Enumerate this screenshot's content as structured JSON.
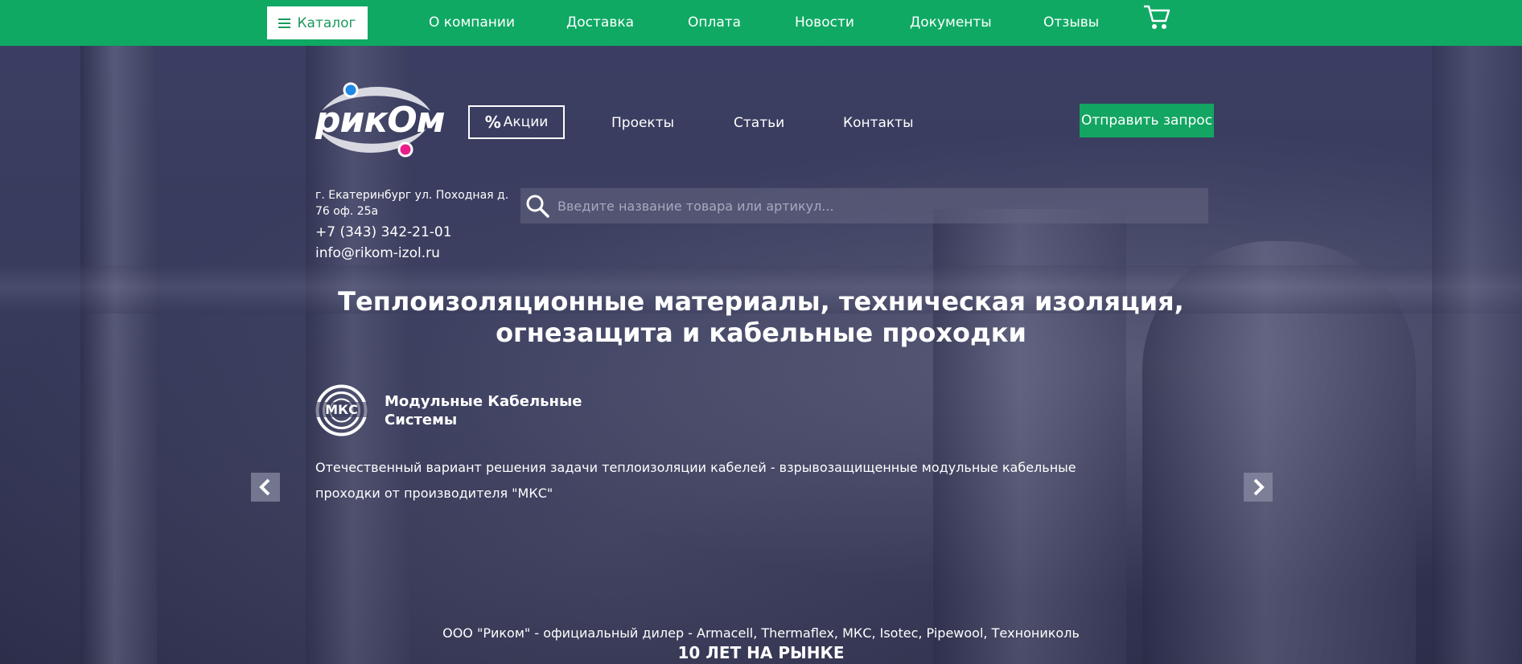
{
  "topbar": {
    "catalog_label": "Каталог",
    "nav": [
      "О компании",
      "Доставка",
      "Оплата",
      "Новости",
      "Документы",
      "Отзывы"
    ]
  },
  "header": {
    "logo_text": "рикОм",
    "promo_label": "Акции",
    "promo_symbol": "%",
    "nav": [
      "Проекты",
      "Статьи",
      "Контакты"
    ],
    "request_button": "Отправить запрос"
  },
  "contacts": {
    "address": "г. Екатеринбург ул. Походная д. 76 оф. 25а",
    "phone": "+7 (343) 342-21-01",
    "email": "info@rikom-izol.ru"
  },
  "search": {
    "placeholder": "Введите название товара или артикул..."
  },
  "hero": {
    "title_line1": "Теплоизоляционные материалы, техническая изоляция,",
    "title_line2": "огнезащита и кабельные проходки"
  },
  "slide": {
    "brand_abbr": "МКС",
    "brand_line1": "Модульные Кабельные",
    "brand_line2": "Системы",
    "text": "Отечественный вариант решения задачи теплоизоляции кабелей - взрывозащищенные модульные кабельные проходки от производителя \"МКС\""
  },
  "footer": {
    "dealer_text": "ООО \"Риком\" - официальный дилер - Armacell, Thermaflex, МКС, Isotec, Pipewool, Технониколь",
    "years_text": "10 ЛЕТ НА РЫНКЕ"
  },
  "colors": {
    "brand_green": "#0fa964",
    "logo_blue": "#1e88e5",
    "logo_pink": "#e91e8c"
  }
}
